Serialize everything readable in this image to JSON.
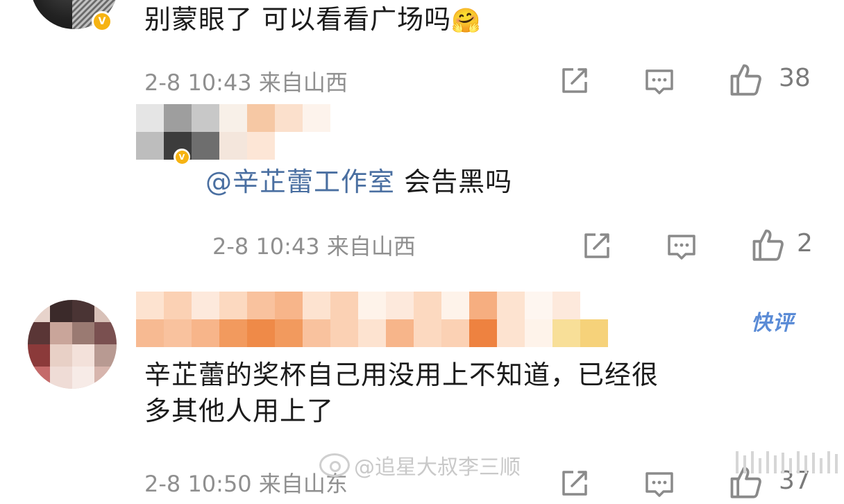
{
  "comments": [
    {
      "text": "别蒙眼了 可以看看广场吗",
      "emoji": "🤗",
      "meta": "2-8 10:43 来自山西",
      "likes": "38",
      "verified": "V"
    },
    {
      "mention": "@辛芷蕾工作室",
      "text": " 会告黑吗",
      "meta": "2-8 10:43 来自山西",
      "likes": "2",
      "verified": "V"
    },
    {
      "text_line1": "辛芷蕾的奖杯自己用没用上不知道，已经很",
      "text_line2": "多其他人用上了",
      "badge": "快评",
      "meta": "2-8 10:50 来自山东",
      "likes": "37"
    }
  ],
  "watermark": {
    "text": "@追星大叔李三顺"
  },
  "icons": {
    "repost": "repost-icon",
    "comment": "comment-icon",
    "like": "like-icon"
  },
  "colors": {
    "mention": "#4a6fa1",
    "verified": "#f6b312",
    "kuaiping": "#5a8bd6",
    "meta": "#8f8f8f"
  }
}
